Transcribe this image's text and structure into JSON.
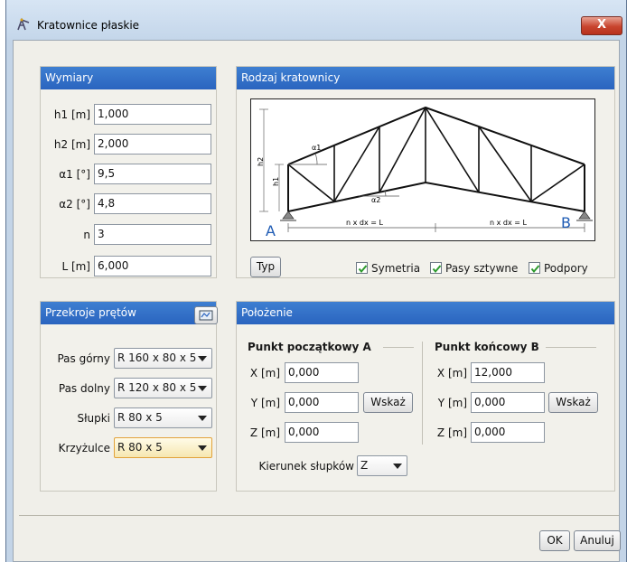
{
  "window": {
    "title": "Kratownice płaskie",
    "close_glyph": "X"
  },
  "wymiary": {
    "header": "Wymiary",
    "rows": [
      {
        "label": "h1 [m]",
        "value": "1,000"
      },
      {
        "label": "h2 [m]",
        "value": "2,000"
      },
      {
        "label": "α1 [°]",
        "value": "9,5"
      },
      {
        "label": "α2 [°]",
        "value": "4,8"
      },
      {
        "label": "n",
        "value": "3"
      },
      {
        "label": "L [m]",
        "value": "6,000"
      }
    ]
  },
  "rodzaj": {
    "header": "Rodzaj kratownicy",
    "typ_button": "Typ",
    "diagram": {
      "h2": "h2",
      "h1": "h1",
      "a1": "α1",
      "a2": "α2",
      "point_a": "A",
      "point_b": "B",
      "dim_left": "n x dx = L",
      "dim_right": "n x dx = L"
    },
    "checkboxes": [
      {
        "label": "Symetria",
        "checked": true
      },
      {
        "label": "Pasy sztywne",
        "checked": true
      },
      {
        "label": "Podpory",
        "checked": true
      }
    ]
  },
  "przekroje": {
    "header": "Przekroje prętów",
    "header_icon": "section-picker-icon",
    "rows": [
      {
        "label": "Pas górny",
        "value": "R 160 x 80 x 5"
      },
      {
        "label": "Pas dolny",
        "value": "R 120 x 80 x 5"
      },
      {
        "label": "Słupki",
        "value": "R 80 x 5"
      },
      {
        "label": "Krzyżulce",
        "value": "R 80 x 5"
      }
    ]
  },
  "polozenie": {
    "header": "Położenie",
    "start": {
      "title": "Punkt początkowy A",
      "x_label": "X [m]",
      "x": "0,000",
      "y_label": "Y [m]",
      "y": "0,000",
      "z_label": "Z [m]",
      "z": "0,000",
      "pick": "Wskaż"
    },
    "end": {
      "title": "Punkt końcowy B",
      "x_label": "X [m]",
      "x": "12,000",
      "y_label": "Y [m]",
      "y": "0,000",
      "z_label": "Z [m]",
      "z": "0,000",
      "pick": "Wskaż"
    },
    "direction_label": "Kierunek słupków",
    "direction_value": "Z"
  },
  "footer": {
    "ok": "OK",
    "cancel": "Anuluj"
  },
  "colors": {
    "header_blue": "#2f6fca",
    "title_blue": "#c4d6ea",
    "close_red": "#c8452e",
    "check_green": "#2d9a2d"
  }
}
